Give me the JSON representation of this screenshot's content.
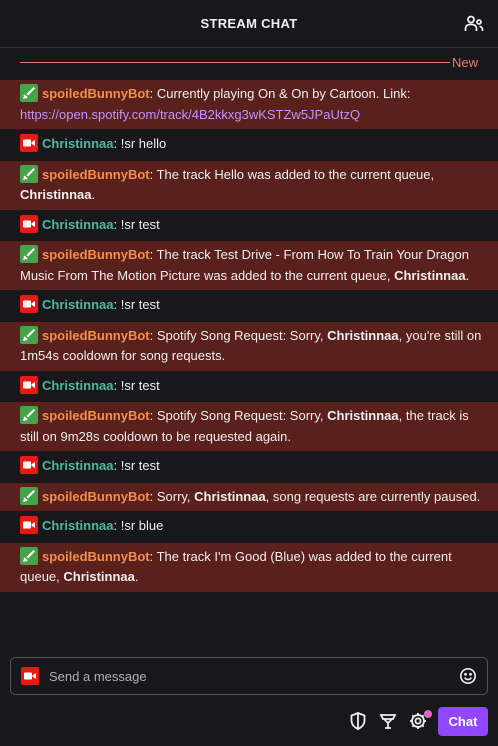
{
  "header": {
    "title": "STREAM CHAT"
  },
  "new_label": "New",
  "colors": {
    "bot_name": "#f0904b",
    "user_name": "#4fb8a4",
    "highlight_bg": "#59201c",
    "accent": "#9147ff",
    "link": "#bf94ff"
  },
  "messages": [
    {
      "type": "bot",
      "user": "spoiledBunnyBot",
      "parts": [
        ": Currently playing On & On by Cartoon. Link: "
      ],
      "link": "https://open.spotify.com/track/4B2kkxg3wKSTZw5JPaUtzQ"
    },
    {
      "type": "user",
      "user": "Christinnaa",
      "parts": [
        ": !sr hello"
      ]
    },
    {
      "type": "bot",
      "user": "spoiledBunnyBot",
      "parts": [
        ": The track Hello was added to the current queue, ",
        "Christinnaa",
        "."
      ]
    },
    {
      "type": "user",
      "user": "Christinnaa",
      "parts": [
        ": !sr test"
      ]
    },
    {
      "type": "bot",
      "user": "spoiledBunnyBot",
      "parts": [
        ": The track Test Drive - From How To Train Your Dragon Music From The Motion Picture was added to the current queue, ",
        "Christinnaa",
        "."
      ]
    },
    {
      "type": "user",
      "user": "Christinnaa",
      "parts": [
        ": !sr test"
      ]
    },
    {
      "type": "bot",
      "user": "spoiledBunnyBot",
      "parts": [
        ": Spotify Song Request: Sorry, ",
        "Christinnaa",
        ", you're still on 1m54s cooldown for song requests."
      ]
    },
    {
      "type": "user",
      "user": "Christinnaa",
      "parts": [
        ": !sr test"
      ]
    },
    {
      "type": "bot",
      "user": "spoiledBunnyBot",
      "parts": [
        ": Spotify Song Request: Sorry, ",
        "Christinnaa",
        ", the track is still on 9m28s cooldown to be requested again."
      ]
    },
    {
      "type": "user",
      "user": "Christinnaa",
      "parts": [
        ": !sr test"
      ]
    },
    {
      "type": "bot",
      "user": "spoiledBunnyBot",
      "parts": [
        ": Sorry, ",
        "Christinnaa",
        ", song requests are currently paused."
      ]
    },
    {
      "type": "user",
      "user": "Christinnaa",
      "parts": [
        ": !sr blue"
      ]
    },
    {
      "type": "bot",
      "user": "spoiledBunnyBot",
      "parts": [
        ": The track I'm Good (Blue) was added to the current queue, ",
        "Christinnaa",
        "."
      ]
    }
  ],
  "input": {
    "placeholder": "Send a message"
  },
  "toolbar": {
    "chat_label": "Chat"
  }
}
